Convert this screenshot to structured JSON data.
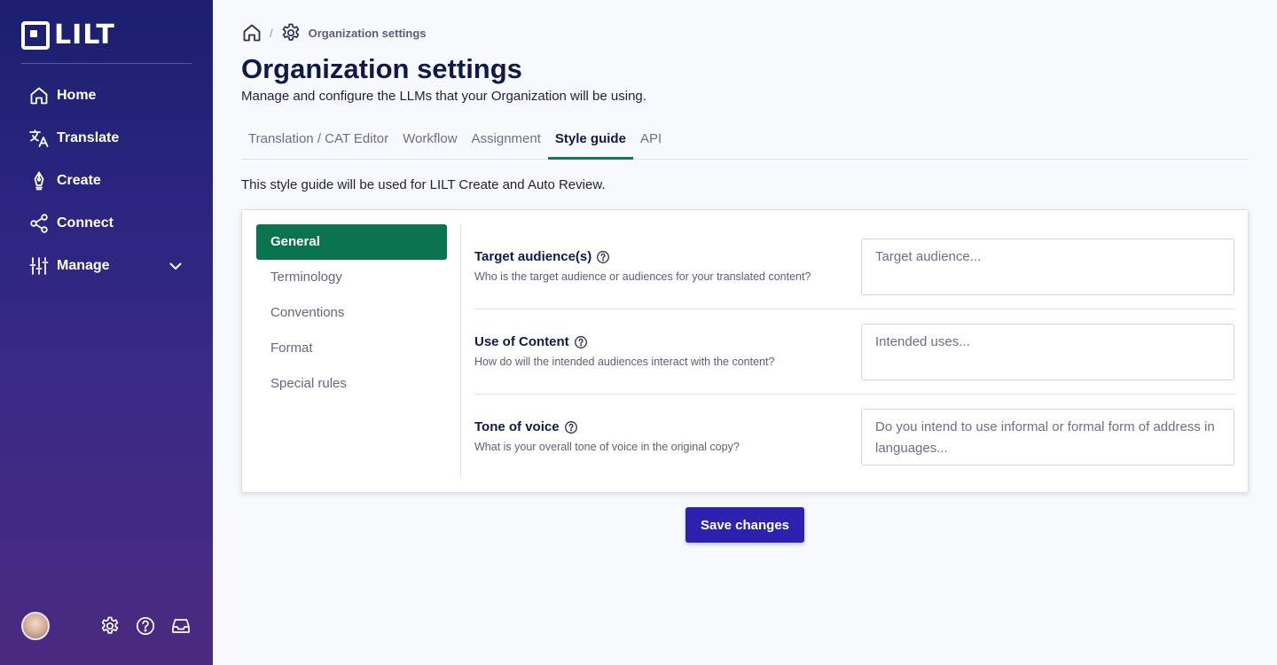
{
  "brand": {
    "name": "LILT"
  },
  "sidebar": {
    "items": [
      {
        "label": "Home",
        "icon": "home-icon"
      },
      {
        "label": "Translate",
        "icon": "translate-icon"
      },
      {
        "label": "Create",
        "icon": "pen-icon"
      },
      {
        "label": "Connect",
        "icon": "share-icon"
      },
      {
        "label": "Manage",
        "icon": "sliders-icon"
      }
    ],
    "footer_icons": [
      "settings-icon",
      "help-icon",
      "inbox-icon"
    ]
  },
  "breadcrumb": {
    "separator": "/",
    "current": "Organization settings"
  },
  "page": {
    "title": "Organization settings",
    "subtitle": "Manage and configure the LLMs that your Organization will be using."
  },
  "tabs": [
    {
      "label": "Translation / CAT Editor",
      "active": false
    },
    {
      "label": "Workflow",
      "active": false
    },
    {
      "label": "Assignment",
      "active": false
    },
    {
      "label": "Style guide",
      "active": true
    },
    {
      "label": "API",
      "active": false
    }
  ],
  "style_guide": {
    "intro": "This style guide will be used for LILT Create and Auto Review.",
    "subnav": [
      "General",
      "Terminology",
      "Conventions",
      "Format",
      "Special rules"
    ],
    "fields": [
      {
        "label": "Target audience(s)",
        "description": "Who is the target audience or audiences for your translated content?",
        "value": "",
        "placeholder": "Target audience..."
      },
      {
        "label": "Use of Content",
        "description": "How do will the intended audiences interact with the content?",
        "value": "",
        "placeholder": "Intended uses..."
      },
      {
        "label": "Tone of voice",
        "description": "What is your overall tone of voice in the original copy?",
        "value": "",
        "placeholder": "Do you intend to use informal or formal form of address in languages..."
      }
    ],
    "save_label": "Save changes"
  },
  "colors": {
    "accent_green": "#0a7350",
    "primary_button": "#2d22b0",
    "sidebar_top": "#1b1f6e",
    "sidebar_bottom": "#4a2a7f"
  }
}
